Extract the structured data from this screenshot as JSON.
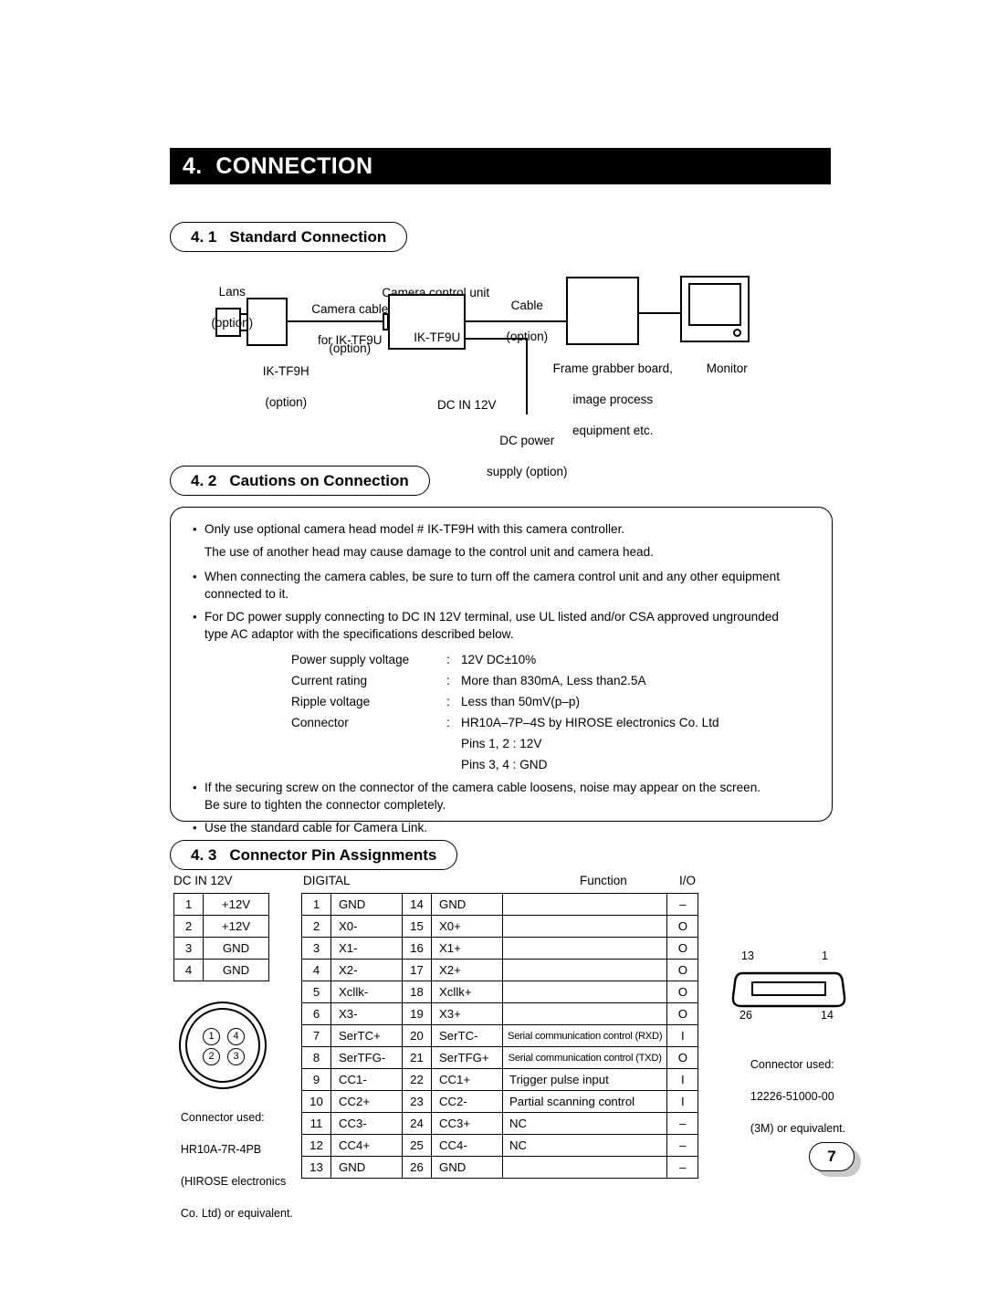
{
  "chapter": {
    "title": "4.  CONNECTION"
  },
  "sections": {
    "s41": {
      "num": "4. 1",
      "label": "Standard Connection"
    },
    "s42": {
      "num": "4. 2",
      "label": "Cautions on Connection"
    },
    "s43": {
      "num": "4. 3",
      "label": "Connector Pin Assignments"
    }
  },
  "diagram": {
    "lens_l1": "Lans",
    "lens_l2": "(option)",
    "head_l1": "IK-TF9H",
    "head_l2": "(option)",
    "camera_cable_l1": "Camera cable",
    "camera_cable_l2": "for IK-TF9U",
    "camera_cable_l3": "(option)",
    "ccu_caption": "Camera control unit",
    "ccu_box": "IK-TF9U",
    "cable_l1": "Cable",
    "cable_l2": "(option)",
    "grabber_l1": "Frame grabber board,",
    "grabber_l2": "image process",
    "grabber_l3": "equipment etc.",
    "monitor": "Monitor",
    "dc_in": "DC IN 12V",
    "dc_power_l1": "DC power",
    "dc_power_l2": "supply (option)"
  },
  "cautions": {
    "bullet": "•",
    "items": [
      {
        "lines": [
          "Only use optional camera head model # IK-TF9H with this camera controller."
        ],
        "sub": "The use of another head may cause damage to the control unit and camera head."
      },
      {
        "lines": [
          "When connecting the camera cables, be sure to turn off the camera control unit and any other equipment",
          "connected to it."
        ]
      },
      {
        "lines": [
          "For DC power supply connecting to DC IN 12V terminal, use UL listed and/or CSA approved ungrounded",
          "type AC adaptor with the specifications described below."
        ]
      },
      {
        "lines": [
          "If the securing screw on the connector of the camera cable loosens, noise may appear on the screen.",
          "Be sure to tighten the connector completely."
        ]
      },
      {
        "lines": [
          "Use the standard cable for Camera Link."
        ]
      }
    ],
    "specs": [
      {
        "key": "Power supply voltage",
        "sep": ":",
        "val": "12V DC±10%"
      },
      {
        "key": "Current rating",
        "sep": ":",
        "val": "More than 830mA, Less than2.5A"
      },
      {
        "key": "Ripple voltage",
        "sep": ":",
        "val": "Less than 50mV(p–p)"
      },
      {
        "key": "Connector",
        "sep": ":",
        "val": "HR10A–7P–4S by HIROSE electronics Co. Ltd"
      },
      {
        "key": "",
        "sep": "",
        "val": "Pins 1, 2 : 12V"
      },
      {
        "key": "",
        "sep": "",
        "val": "Pins 3, 4 : GND"
      }
    ]
  },
  "pin_assignments": {
    "dcin": {
      "caption": "DC IN 12V",
      "rows": [
        {
          "pin": "1",
          "sig": "+12V"
        },
        {
          "pin": "2",
          "sig": "+12V"
        },
        {
          "pin": "3",
          "sig": "GND"
        },
        {
          "pin": "4",
          "sig": "GND"
        }
      ],
      "connector_note": [
        "Connector used:",
        "HR10A-7R-4PB",
        "(HIROSE electronics",
        "Co. Ltd) or equivalent."
      ],
      "pin_dots": [
        "1",
        "4",
        "2",
        "3"
      ]
    },
    "digital": {
      "caption": "DIGITAL",
      "head_function": "Function",
      "head_io": "I/O",
      "rows": [
        {
          "pin_a": "1",
          "sig_a": "GND",
          "pin_b": "14",
          "sig_b": "GND",
          "fn": "",
          "io": "–"
        },
        {
          "pin_a": "2",
          "sig_a": "X0-",
          "pin_b": "15",
          "sig_b": "X0+",
          "fn": "",
          "io": "O"
        },
        {
          "pin_a": "3",
          "sig_a": "X1-",
          "pin_b": "16",
          "sig_b": "X1+",
          "fn": "",
          "io": "O"
        },
        {
          "pin_a": "4",
          "sig_a": "X2-",
          "pin_b": "17",
          "sig_b": "X2+",
          "fn": "",
          "io": "O"
        },
        {
          "pin_a": "5",
          "sig_a": "Xcllk-",
          "pin_b": "18",
          "sig_b": "Xcllk+",
          "fn": "",
          "io": "O"
        },
        {
          "pin_a": "6",
          "sig_a": "X3-",
          "pin_b": "19",
          "sig_b": "X3+",
          "fn": "",
          "io": "O"
        },
        {
          "pin_a": "7",
          "sig_a": "SerTC+",
          "pin_b": "20",
          "sig_b": "SerTC-",
          "fn": "Serial communication control (RXD)",
          "io": "I"
        },
        {
          "pin_a": "8",
          "sig_a": "SerTFG-",
          "pin_b": "21",
          "sig_b": "SerTFG+",
          "fn": "Serial communication control (TXD)",
          "io": "O"
        },
        {
          "pin_a": "9",
          "sig_a": "CC1-",
          "pin_b": "22",
          "sig_b": "CC1+",
          "fn": "Trigger pulse input",
          "io": "I"
        },
        {
          "pin_a": "10",
          "sig_a": "CC2+",
          "pin_b": "23",
          "sig_b": "CC2-",
          "fn": "Partial scanning control",
          "io": "I"
        },
        {
          "pin_a": "11",
          "sig_a": "CC3-",
          "pin_b": "24",
          "sig_b": "CC3+",
          "fn": "NC",
          "io": "–"
        },
        {
          "pin_a": "12",
          "sig_a": "CC4+",
          "pin_b": "25",
          "sig_b": "CC4-",
          "fn": "NC",
          "io": "–"
        },
        {
          "pin_a": "13",
          "sig_a": "GND",
          "pin_b": "26",
          "sig_b": "GND",
          "fn": "",
          "io": "–"
        }
      ],
      "connector_corners": {
        "tl": "13",
        "tr": "1",
        "bl": "26",
        "br": "14"
      },
      "connector_note": [
        "Connector used:",
        "12226-51000-00",
        "(3M) or equivalent."
      ]
    }
  },
  "footer": {
    "page_number": "7"
  }
}
